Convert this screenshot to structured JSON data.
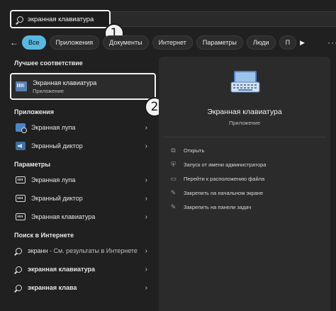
{
  "search": {
    "value": "экранная клавиатура"
  },
  "badges": [
    "1",
    "2"
  ],
  "filters": {
    "back_glyph": "←",
    "chips": [
      "Все",
      "Приложения",
      "Документы",
      "Интернет",
      "Параметры",
      "Люди",
      "П"
    ],
    "play_glyph": "▶",
    "more_glyph": "···"
  },
  "left": {
    "best_title": "Лучшее соответствие",
    "best": {
      "name": "Экранная клавиатура",
      "type": "Приложение",
      "icon": "keyboard-icon"
    },
    "apps_title": "Приложения",
    "apps": [
      {
        "label": "Экранная лупа",
        "icon": "magnifier-icon"
      },
      {
        "label": "Экранный диктор",
        "icon": "narrator-icon"
      }
    ],
    "settings_title": "Параметры",
    "settings": [
      {
        "label": "Экранная лупа",
        "icon": "settings-icon"
      },
      {
        "label": "Экранный диктор",
        "icon": "settings-icon"
      },
      {
        "label": "Экранная клавиатура",
        "icon": "settings-icon"
      }
    ],
    "web_title": "Поиск в Интернете",
    "web": [
      {
        "label": "экранн",
        "suffix": " - См. результаты в Интернете"
      },
      {
        "label": "экранная клавиатура",
        "suffix": ""
      },
      {
        "label": "экранная клава",
        "suffix": ""
      }
    ],
    "chevron": "›"
  },
  "right": {
    "title": "Экранная клавиатура",
    "subtitle": "Приложение",
    "actions": [
      {
        "label": "Открыть",
        "icon": "open-icon",
        "glyph": "⧉"
      },
      {
        "label": "Запуск от имени администратора",
        "icon": "shield-icon",
        "glyph": "⛨"
      },
      {
        "label": "Перейти к расположению файла",
        "icon": "folder-icon",
        "glyph": "▭"
      },
      {
        "label": "Закрепить на начальном экране",
        "icon": "pin-icon",
        "glyph": "✎"
      },
      {
        "label": "Закрепить на панели задач",
        "icon": "pin-taskbar-icon",
        "glyph": "✎"
      }
    ]
  },
  "colors": {
    "accent": "#58b8e0",
    "background": "#202020",
    "panel": "#2b2b2b",
    "highlight": "#f2f2f2"
  }
}
